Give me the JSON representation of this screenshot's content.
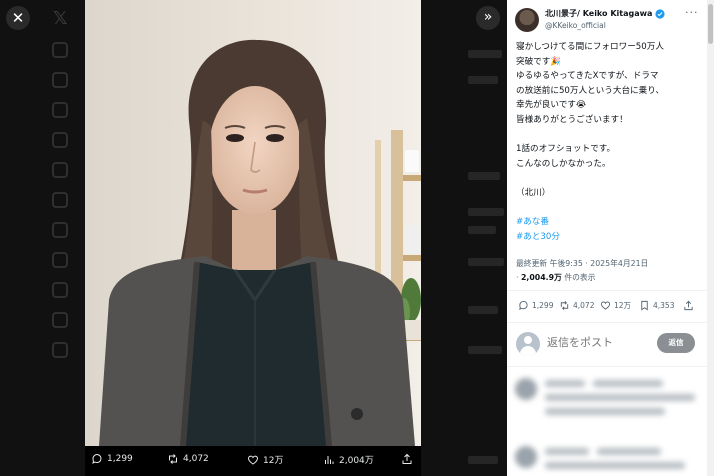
{
  "viewer": {
    "close_label": "✕",
    "expand_label": "»",
    "media_bar": {
      "replies": "1,299",
      "reposts": "4,072",
      "likes": "12万",
      "views": "2,004万"
    }
  },
  "post": {
    "author_name": "北川景子/ Keiko Kitagawa",
    "author_handle": "@KKeiko_official",
    "verified": true,
    "more_label": "···",
    "text_lines": [
      "寝かしつけてる間にフォロワー50万人",
      "突破です",
      "ゆるゆるやってきたXですが、ドラマ",
      "の放送前に50万人という大台に乗り、",
      "幸先が良いです",
      "皆様ありがとうございます！",
      "",
      "1話のオフショットです。",
      "こんなのしかなかった。",
      "",
      "（北川）",
      ""
    ],
    "emoji_party": "🎉",
    "emoji_cry": "😭",
    "hashtags": [
      "#あな番",
      "#あと30分"
    ],
    "meta": {
      "edited": "最終更新",
      "time": "午後9:35",
      "date": "2025年4月21日",
      "dot": "·",
      "views_count": "2,004.9万",
      "views_label": "件の表示"
    },
    "actions": {
      "replies": "1,299",
      "reposts": "4,072",
      "likes": "12万",
      "bookmarks": "4,353"
    }
  },
  "reply_box": {
    "placeholder": "返信をポスト",
    "button": "返信"
  },
  "colors": {
    "accent": "#1d9bf0",
    "secondary_text": "#536471",
    "reply_button": "#8b8f93"
  }
}
